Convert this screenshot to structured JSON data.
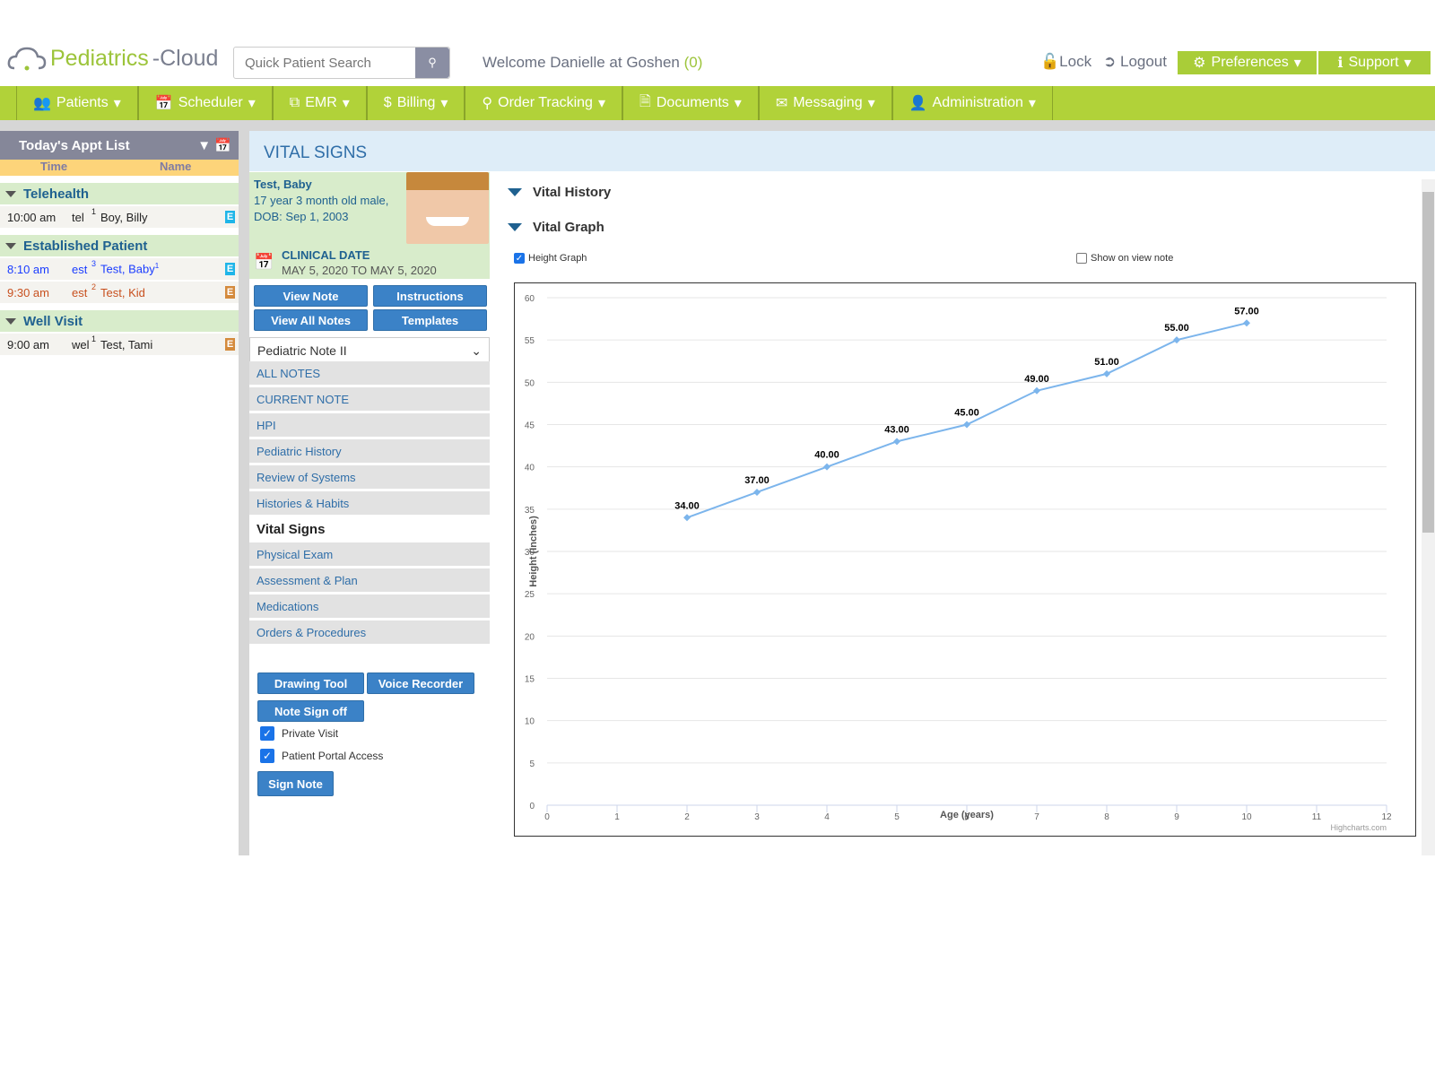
{
  "header": {
    "logo_a": "Pediatrics",
    "logo_b": "-Cloud",
    "search_placeholder": "Quick Patient Search",
    "welcome": "Welcome Danielle at Goshen",
    "welcome_count": "(0)",
    "lock": "Lock",
    "logout": "Logout",
    "preferences": "Preferences",
    "support": "Support"
  },
  "nav": [
    {
      "label": "Patients"
    },
    {
      "label": "Scheduler"
    },
    {
      "label": "EMR"
    },
    {
      "label": "Billing"
    },
    {
      "label": "Order Tracking"
    },
    {
      "label": "Documents"
    },
    {
      "label": "Messaging"
    },
    {
      "label": "Administration"
    }
  ],
  "appt": {
    "title": "Today's Appt List",
    "col_time": "Time",
    "col_name": "Name",
    "groups": [
      {
        "label": "Telehealth",
        "rows": [
          {
            "time": "10:00 am",
            "type": "tel",
            "num": "1",
            "name": "Boy, Billy",
            "badge": "E",
            "color": "#222222",
            "badge_color": "#1fb5e8"
          }
        ]
      },
      {
        "label": "Established Patient",
        "rows": [
          {
            "time": "8:10 am",
            "type": "est",
            "num": "3",
            "name": "Test, Baby",
            "sup": "1",
            "badge": "E",
            "color": "#1a3cff",
            "badge_color": "#1fb5e8"
          },
          {
            "time": "9:30 am",
            "type": "est",
            "num": "2",
            "name": "Test, Kid",
            "badge": "E",
            "color": "#c8501e",
            "badge_color": "#d48a3c"
          }
        ]
      },
      {
        "label": "Well Visit",
        "rows": [
          {
            "time": "9:00 am",
            "type": "wel",
            "num": "1",
            "name": "Test, Tami",
            "badge": "E",
            "color": "#222222",
            "badge_color": "#d48a3c"
          }
        ]
      }
    ]
  },
  "page_title": "VITAL SIGNS",
  "patient": {
    "name": "Test, Baby",
    "age": "17 year 3 month old male,",
    "dob": "DOB: Sep 1, 2003",
    "clinical_label": "CLINICAL DATE",
    "clinical_range": "MAY 5, 2020 TO MAY 5, 2020"
  },
  "buttons": {
    "view_note": "View Note",
    "instructions": "Instructions",
    "view_all": "View All Notes",
    "templates": "Templates",
    "drawing": "Drawing Tool",
    "voice": "Voice Recorder",
    "signoff": "Note Sign off",
    "sign": "Sign Note"
  },
  "note_select": "Pediatric Note II",
  "menu": [
    "ALL NOTES",
    "CURRENT NOTE",
    "HPI",
    "Pediatric History",
    "Review of Systems",
    "Histories & Habits",
    "Vital Signs",
    "Physical Exam",
    "Assessment & Plan",
    "Medications",
    "Orders & Procedures"
  ],
  "checks": {
    "private": "Private Visit",
    "portal": "Patient Portal Access"
  },
  "sections": {
    "history": "Vital History",
    "graph": "Vital Graph",
    "height_graph": "Height Graph",
    "show_on_note": "Show on view note"
  },
  "chart_data": {
    "type": "line",
    "title": "",
    "xlabel": "Age (years)",
    "ylabel": "Height (Inches)",
    "xlim": [
      0,
      12
    ],
    "ylim": [
      0,
      60
    ],
    "xticks": [
      0,
      1,
      2,
      3,
      4,
      5,
      6,
      7,
      8,
      9,
      10,
      11,
      12
    ],
    "yticks": [
      0,
      5,
      10,
      15,
      20,
      25,
      30,
      35,
      40,
      45,
      50,
      55,
      60
    ],
    "x": [
      2,
      3,
      4,
      5,
      6,
      7,
      8,
      9,
      10
    ],
    "values": [
      34,
      37,
      40,
      43,
      45,
      49,
      51,
      55,
      57
    ],
    "labels": [
      "34.00",
      "37.00",
      "40.00",
      "43.00",
      "45.00",
      "49.00",
      "51.00",
      "55.00",
      "57.00"
    ],
    "credit": "Highcharts.com",
    "color": "#7cb5ec"
  }
}
